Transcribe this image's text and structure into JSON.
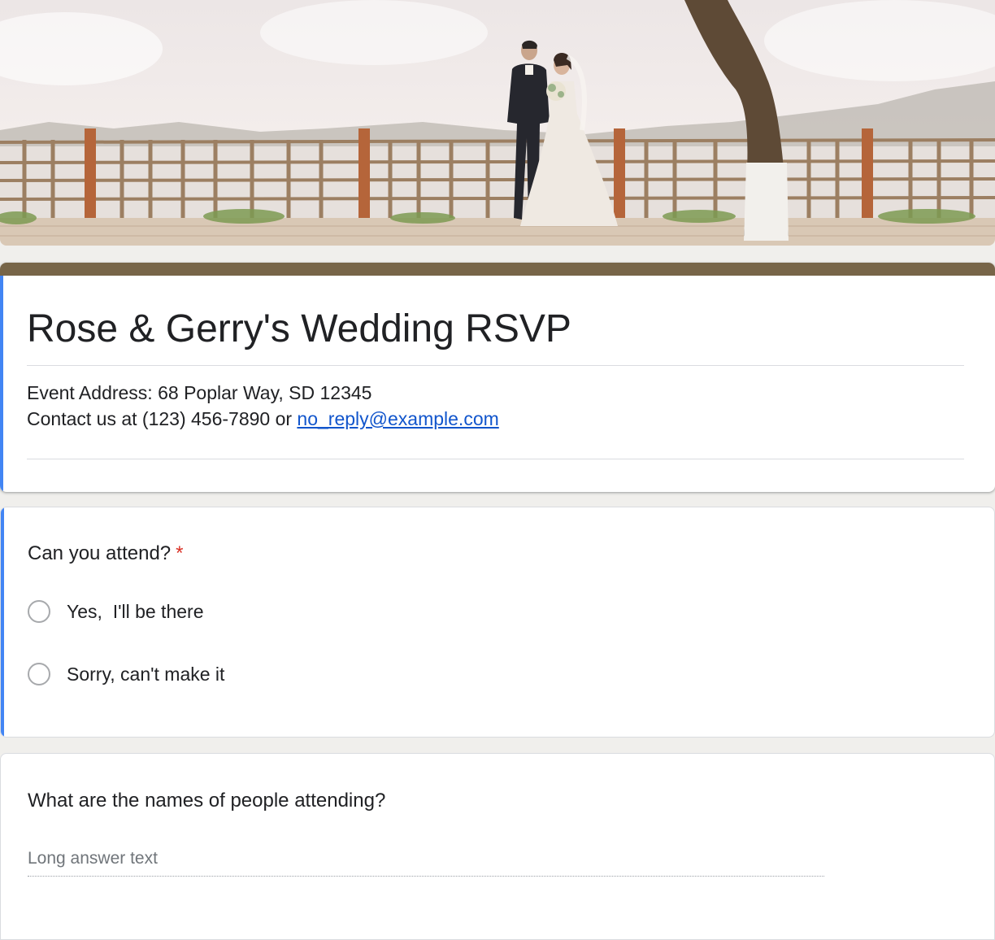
{
  "form": {
    "title": "Rose & Gerry's Wedding RSVP",
    "description_line1": "Event Address: 68 Poplar Way, SD 12345",
    "description_line2_prefix": "Contact us at (123) 456-7890 or ",
    "contact_email": "no_reply@example.com"
  },
  "colors": {
    "theme_bar": "#776548",
    "focus_accent": "#4285f4",
    "required": "#d93025",
    "link": "#1155cc",
    "page_background": "#f0efec"
  },
  "questions": [
    {
      "label": "Can you attend?",
      "required_mark": "*",
      "type": "radio",
      "options": [
        "Yes,  I'll be there",
        "Sorry, can't make it"
      ]
    },
    {
      "label": "What are the names of people attending?",
      "type": "paragraph",
      "placeholder": "Long answer text"
    }
  ],
  "header_image": {
    "icon": "wedding-couple-photo"
  }
}
